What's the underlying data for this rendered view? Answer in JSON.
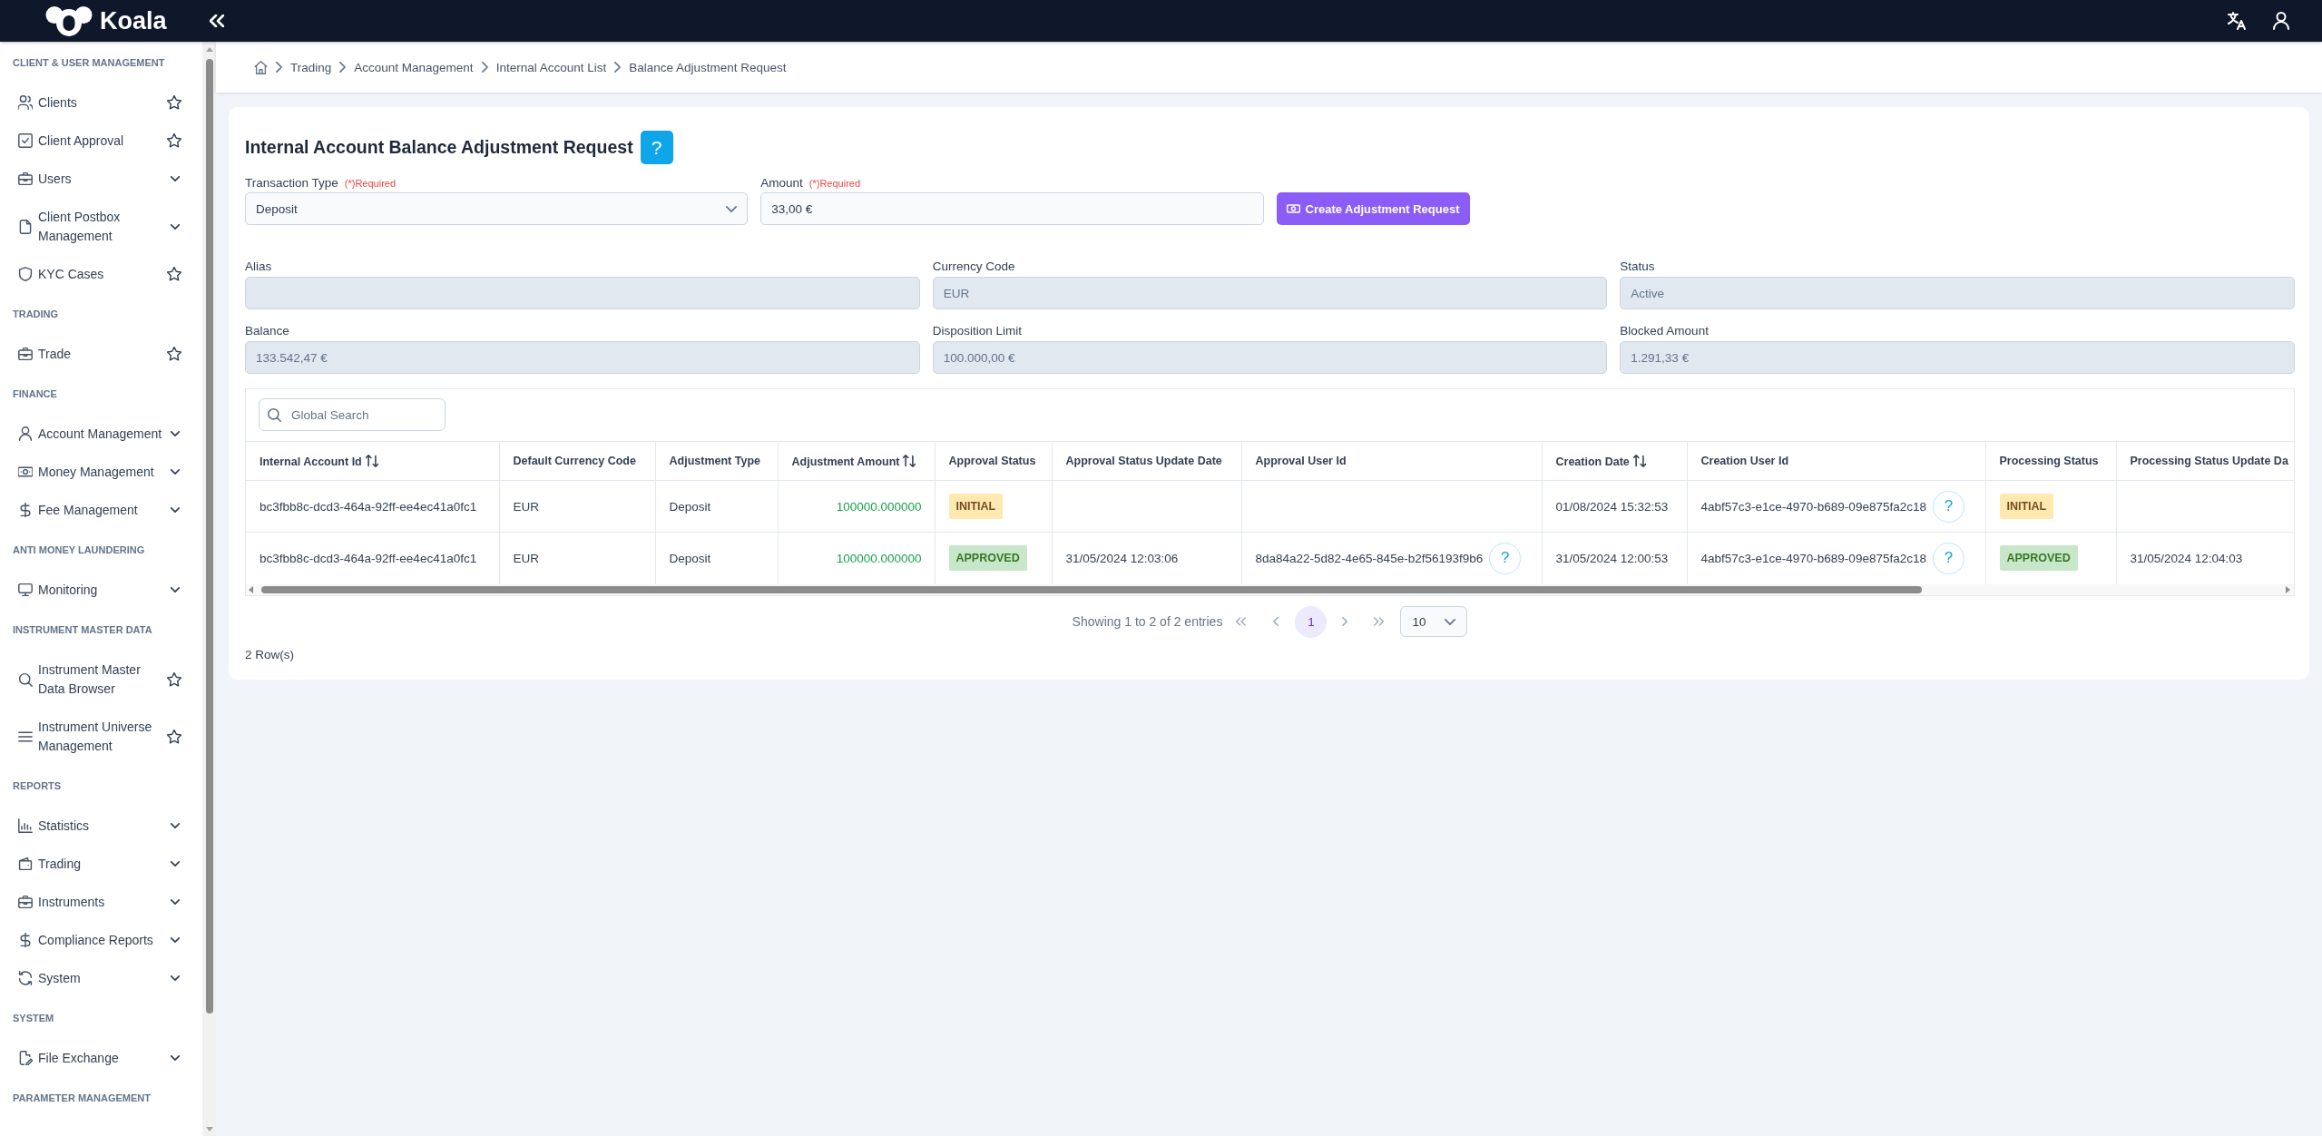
{
  "header": {
    "logo": "Koala"
  },
  "sidebar": {
    "sections": [
      {
        "title": "CLIENT & USER MANAGEMENT",
        "items": [
          {
            "label": "Clients",
            "kind": "page"
          },
          {
            "label": "Client Approval",
            "kind": "page"
          },
          {
            "label": "Users",
            "kind": "group"
          },
          {
            "label": "Client Postbox Management",
            "kind": "group"
          },
          {
            "label": "KYC Cases",
            "kind": "page"
          }
        ]
      },
      {
        "title": "TRADING",
        "items": [
          {
            "label": "Trade",
            "kind": "page"
          }
        ]
      },
      {
        "title": "FINANCE",
        "items": [
          {
            "label": "Account Management",
            "kind": "group"
          },
          {
            "label": "Money Management",
            "kind": "group"
          },
          {
            "label": "Fee Management",
            "kind": "group"
          }
        ]
      },
      {
        "title": "ANTI MONEY LAUNDERING",
        "items": [
          {
            "label": "Monitoring",
            "kind": "group"
          }
        ]
      },
      {
        "title": "INSTRUMENT MASTER DATA",
        "items": [
          {
            "label": "Instrument Master Data Browser",
            "kind": "page"
          },
          {
            "label": "Instrument Universe Management",
            "kind": "page"
          }
        ]
      },
      {
        "title": "REPORTS",
        "items": [
          {
            "label": "Statistics",
            "kind": "group"
          },
          {
            "label": "Trading",
            "kind": "group"
          },
          {
            "label": "Instruments",
            "kind": "group"
          },
          {
            "label": "Compliance Reports",
            "kind": "group"
          },
          {
            "label": "System",
            "kind": "group"
          }
        ]
      },
      {
        "title": "SYSTEM",
        "items": [
          {
            "label": "File Exchange",
            "kind": "group"
          }
        ]
      },
      {
        "title": "PARAMETER MANAGEMENT"
      }
    ]
  },
  "breadcrumb": [
    "Trading",
    "Account Management",
    "Internal Account List",
    "Balance Adjustment Request"
  ],
  "page": {
    "title": "Internal Account Balance Adjustment Request",
    "help_button": "?",
    "request_fields": [
      {
        "kind": "select",
        "label": "Transaction Type",
        "required_note": "(*)Required",
        "value": "Deposit",
        "disabled": false
      },
      {
        "kind": "input",
        "label": "Amount",
        "required_note": "(*)Required",
        "value": "33,00 €",
        "disabled": false
      }
    ],
    "submit_button": "Create Adjustment Request",
    "account_fields": [
      {
        "label": "Alias",
        "disabled": true
      },
      {
        "label": "Currency Code",
        "value": "EUR",
        "disabled": true
      },
      {
        "label": "Status",
        "value": "Active",
        "disabled": true
      },
      {
        "label": "Balance",
        "value": "133.542,47 €",
        "disabled": true
      },
      {
        "label": "Disposition Limit",
        "value": "100.000,00 €",
        "disabled": true
      },
      {
        "label": "Blocked Amount",
        "value": "1.291,33 €",
        "disabled": true
      }
    ]
  },
  "table": {
    "search": {
      "placeholder": "Global Search"
    },
    "columns": [
      {
        "label": "Internal Account Id",
        "sortable": true
      },
      {
        "label": "Default Currency Code",
        "sortable": false
      },
      {
        "label": "Adjustment Type",
        "sortable": false
      },
      {
        "label": "Adjustment Amount",
        "sortable": true
      },
      {
        "label": "Approval Status",
        "sortable": false
      },
      {
        "label": "Approval Status Update Date",
        "sortable": false
      },
      {
        "label": "Approval User Id",
        "sortable": false
      },
      {
        "label": "Creation Date",
        "sortable": true
      },
      {
        "label": "Creation User Id",
        "sortable": false
      },
      {
        "label": "Processing Status",
        "sortable": false
      },
      {
        "label": "Processing Status Update Da",
        "sortable": false
      }
    ],
    "rows": [
      {
        "cells": [
          {
            "kind": "text",
            "value": "bc3fbb8c-dcd3-464a-92ff-ee4ec41a0fc1"
          },
          {
            "kind": "text",
            "value": "EUR"
          },
          {
            "kind": "text",
            "value": "Deposit"
          },
          {
            "kind": "amount",
            "value": "100000.000000"
          },
          {
            "kind": "status",
            "value": "INITIAL",
            "color": "#ffe9b0"
          },
          {
            "kind": "text"
          },
          {
            "kind": "text"
          },
          {
            "kind": "text",
            "value": "01/08/2024 15:32:53"
          },
          {
            "kind": "user",
            "value": "4abf57c3-e1ce-4970-b689-09e875fa2c18",
            "help": "?"
          },
          {
            "kind": "status",
            "value": "INITIAL",
            "color": "#ffe9b0"
          },
          {
            "kind": "text"
          }
        ]
      },
      {
        "cells": [
          {
            "kind": "text",
            "value": "bc3fbb8c-dcd3-464a-92ff-ee4ec41a0fc1"
          },
          {
            "kind": "text",
            "value": "EUR"
          },
          {
            "kind": "text",
            "value": "Deposit"
          },
          {
            "kind": "amount",
            "value": "100000.000000"
          },
          {
            "kind": "status",
            "value": "APPROVED",
            "color": "#c8e6c9"
          },
          {
            "kind": "text",
            "value": "31/05/2024 12:03:06"
          },
          {
            "kind": "user",
            "value": "8da84a22-5d82-4e65-845e-b2f56193f9b6",
            "help": "?"
          },
          {
            "kind": "text",
            "value": "31/05/2024 12:00:53"
          },
          {
            "kind": "user",
            "value": "4abf57c3-e1ce-4970-b689-09e875fa2c18",
            "help": "?"
          },
          {
            "kind": "status",
            "value": "APPROVED",
            "color": "#c8e6c9"
          },
          {
            "kind": "text",
            "value": "31/05/2024 12:04:03"
          }
        ]
      }
    ],
    "pagination": {
      "summary": "Showing 1 to 2 of 2 entries",
      "pages": [
        {
          "label": "1",
          "selected": true
        }
      ],
      "page_size": "10"
    },
    "row_count": "2 Row(s)"
  }
}
